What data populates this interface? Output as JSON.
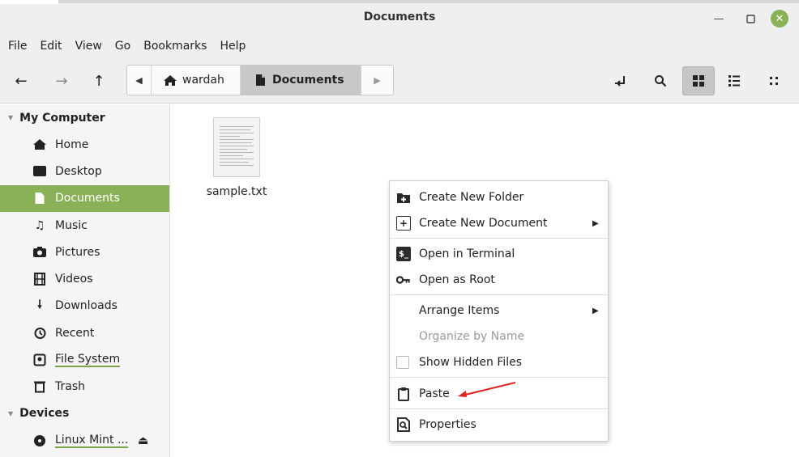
{
  "window": {
    "title": "Documents"
  },
  "menubar": [
    "File",
    "Edit",
    "View",
    "Go",
    "Bookmarks",
    "Help"
  ],
  "pathbar": {
    "home": "wardah",
    "current": "Documents"
  },
  "sidebar": {
    "my_computer": "My Computer",
    "items": [
      {
        "label": "Home",
        "icon": "home-icon"
      },
      {
        "label": "Desktop",
        "icon": "desktop-icon"
      },
      {
        "label": "Documents",
        "icon": "document-icon",
        "active": true
      },
      {
        "label": "Music",
        "icon": "music-icon"
      },
      {
        "label": "Pictures",
        "icon": "camera-icon"
      },
      {
        "label": "Videos",
        "icon": "film-icon"
      },
      {
        "label": "Downloads",
        "icon": "download-icon"
      },
      {
        "label": "Recent",
        "icon": "history-icon"
      },
      {
        "label": "File System",
        "icon": "drive-icon"
      },
      {
        "label": "Trash",
        "icon": "trash-icon"
      }
    ],
    "devices": "Devices",
    "device_items": [
      {
        "label": "Linux Mint ...",
        "icon": "disc-icon"
      }
    ]
  },
  "content": {
    "files": [
      {
        "name": "sample.txt"
      }
    ]
  },
  "context_menu": {
    "items": [
      {
        "label": "Create New Folder",
        "icon": "new-folder-icon"
      },
      {
        "label": "Create New Document",
        "icon": "new-document-icon",
        "submenu": true
      },
      {
        "label": "Open in Terminal",
        "icon": "terminal-icon"
      },
      {
        "label": "Open as Root",
        "icon": "key-icon"
      },
      {
        "label": "Arrange Items",
        "submenu": true
      },
      {
        "label": "Organize by Name",
        "disabled": true
      },
      {
        "label": "Show Hidden Files",
        "checkbox": true,
        "checked": false
      },
      {
        "label": "Paste",
        "icon": "clipboard-icon"
      },
      {
        "label": "Properties",
        "icon": "properties-icon"
      }
    ]
  },
  "colors": {
    "accent": "#8bb158",
    "annotation_arrow": "#e02020"
  }
}
